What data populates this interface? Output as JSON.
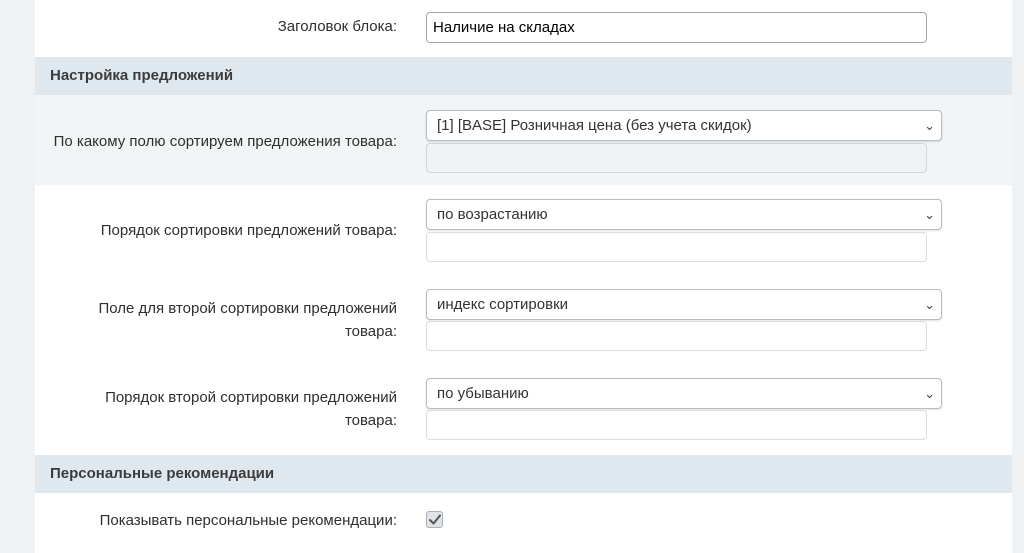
{
  "block_title": {
    "label": "Заголовок блока:",
    "value": "Наличие на складах"
  },
  "offers_settings": {
    "heading": "Настройка предложений",
    "sort_field": {
      "label": "По какому полю сортируем предложения товара:",
      "selected": "[1] [BASE] Розничная цена (без учета скидок)"
    },
    "sort_order": {
      "label": "Порядок сортировки предложений товара:",
      "selected": "по возрастанию"
    },
    "second_sort_field": {
      "label_line1": "Поле для второй сортировки предложений",
      "label_line2": "товара:",
      "selected": "индекс сортировки"
    },
    "second_sort_order": {
      "label_line1": "Порядок второй сортировки предложений",
      "label_line2": "товара:",
      "selected": "по убыванию"
    }
  },
  "personal_recommendations": {
    "heading": "Персональные рекомендации",
    "show": {
      "label": "Показывать персональные рекомендации:",
      "checked": true
    }
  },
  "colors": {
    "page_background": "#eef2f4",
    "section_header": "#e0e8ef",
    "shaded_row": "#f2f5f6"
  },
  "icons": [
    "chevron-down-icon",
    "checkmark-icon"
  ]
}
